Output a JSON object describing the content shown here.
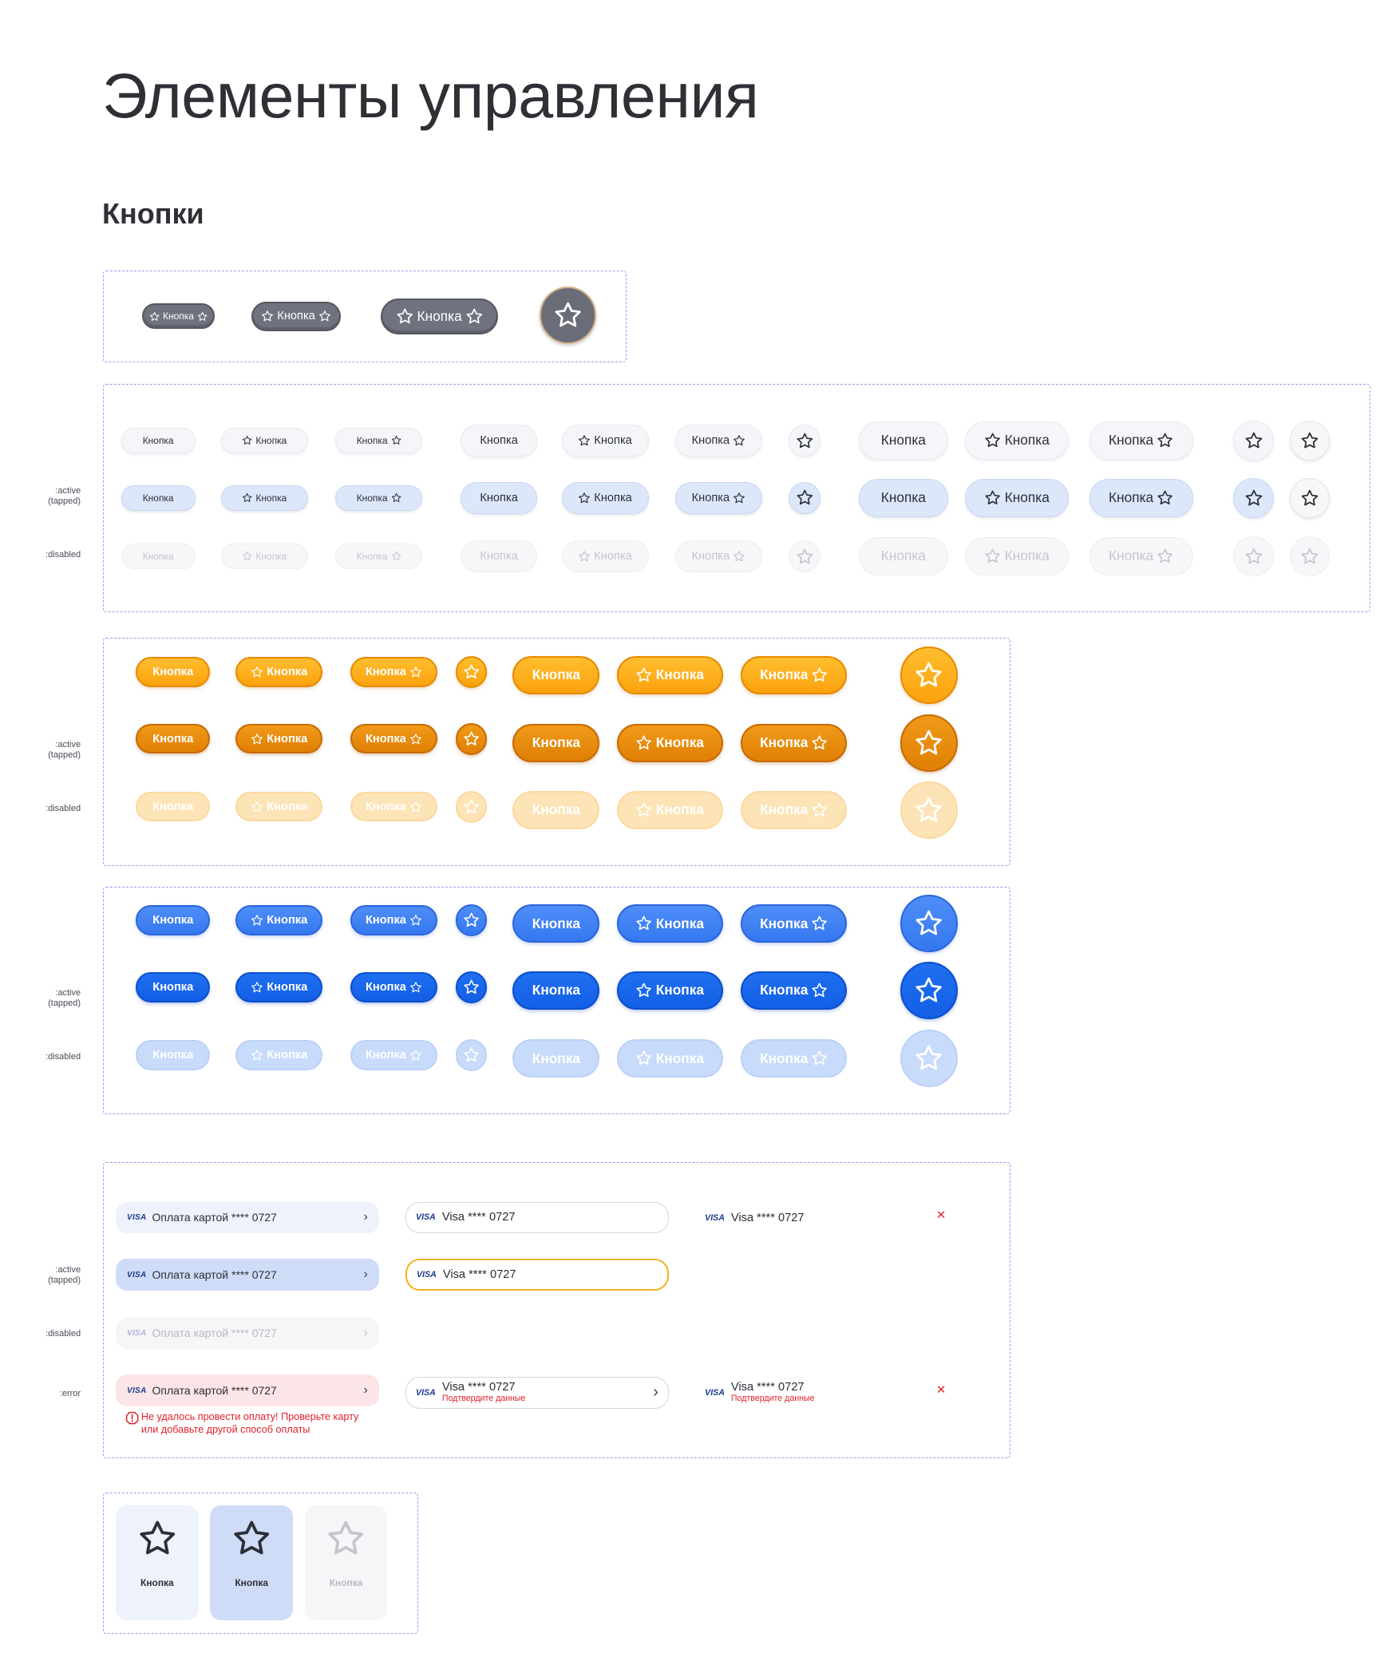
{
  "page": {
    "title": "Элементы управления",
    "section_title": "Кнопки"
  },
  "button_label": "Кнопка",
  "states": {
    "active": ":active\n(tapped)",
    "disabled": ":disabled",
    "error": ":error"
  },
  "colors": {
    "frame_border": "#b58cf0",
    "grey": "#70737f",
    "secondary": "#f5f6f9",
    "secondary_active": "#dde7fa",
    "orange": "#fca20e",
    "orange_active": "#e07f05",
    "orange_disabled": "#fde4b6",
    "blue": "#3578f0",
    "blue_active": "#135fe6",
    "blue_disabled": "#c9dbfb",
    "error": "#e0212b",
    "focus_border": "#f3b11c"
  },
  "icons": {
    "button": "star-icon",
    "chevron": "chevron-right-icon",
    "card_brand": "visa-logo",
    "remove": "close-icon",
    "error": "alert-circle-icon"
  },
  "payment": {
    "visa_logo": "VISA",
    "method_label": "Оплата картой **** 0727",
    "card_label": "Visa **** 0727",
    "hint_error": "Подтвердите данные",
    "remove_icon": "✕",
    "chevron": "›",
    "error_line1": "Не удалось провести оплату! Проверьте карту",
    "error_line2": "или добавьте другой способ оплаты"
  },
  "tiles": [
    {
      "label": "Кнопка",
      "state": "default"
    },
    {
      "label": "Кнопка",
      "state": "active"
    },
    {
      "label": "Кнопка",
      "state": "disabled"
    }
  ]
}
